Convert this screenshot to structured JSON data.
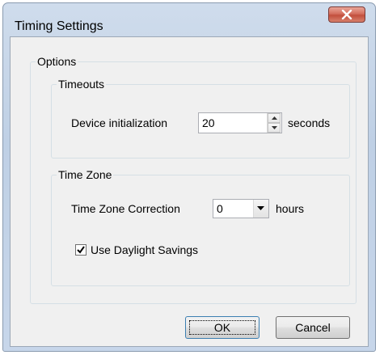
{
  "window": {
    "title": "Timing Settings"
  },
  "options": {
    "title": "Options",
    "timeouts": {
      "title": "Timeouts",
      "device_init_label": "Device initialization",
      "device_init_value": "20",
      "unit_label": "seconds"
    },
    "timezone": {
      "title": "Time Zone",
      "correction_label": "Time Zone Correction",
      "correction_value": "0",
      "unit_label": "hours",
      "daylight_label": "Use Daylight Savings",
      "daylight_checked": true
    }
  },
  "buttons": {
    "ok_label": "OK",
    "cancel_label": "Cancel"
  },
  "colors": {
    "close_button": "#c9503f",
    "client_background": "#f0f0f0",
    "frame": "#c4d5ea"
  },
  "icons": {
    "close": "close-x-icon",
    "spin_up": "spin-up-arrow-icon",
    "spin_down": "spin-down-arrow-icon",
    "dropdown": "chevron-down-icon",
    "check": "checkmark-icon"
  }
}
